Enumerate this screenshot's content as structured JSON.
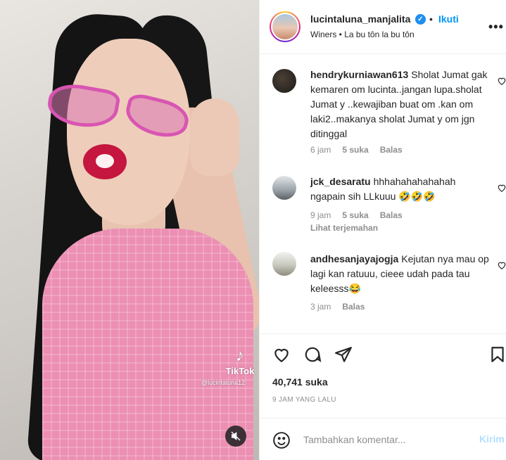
{
  "media": {
    "tiktok_label": "TikTok",
    "tiktok_user": "@lucintaluna12",
    "mute_icon": "muted-speaker-icon"
  },
  "header": {
    "username": "lucintaluna_manjalita",
    "verified_icon": "verified-badge-icon",
    "separator": "•",
    "follow_label": "Ikuti",
    "audio_text": "Winers • La bu tôn la bu tôn",
    "more_icon": "more-options-icon"
  },
  "comments": [
    {
      "username": "hendrykurniawan613",
      "text": "Sholat Jumat gak kemaren om lucinta..jangan lupa.sholat Jumat y ..kewajiban buat om .kan om laki2..makanya sholat Jumat y om jgn ditinggal",
      "time": "6 jam",
      "likes": "5 suka",
      "reply": "Balas"
    },
    {
      "username": "jck_desaratu",
      "text": "hhhahahahahahah ngapain sih LLkuuu 🤣🤣🤣",
      "time": "9 jam",
      "likes": "5 suka",
      "reply": "Balas",
      "translate": "Lihat terjemahan"
    },
    {
      "username": "andhesanjayajogja",
      "text": "Kejutan nya mau op lagi kan ratuuu, cieee udah pada tau keleesss😂",
      "time": "3 jam",
      "reply": "Balas"
    }
  ],
  "actions": {
    "likes": "40,741 suka",
    "timestamp": "9 JAM YANG LALU"
  },
  "composer": {
    "placeholder": "Tambahkan komentar...",
    "post_label": "Kirim"
  },
  "colors": {
    "accent": "#0095f6",
    "post_disabled": "#b2dffc",
    "secondary_text": "#8e8e8e"
  }
}
